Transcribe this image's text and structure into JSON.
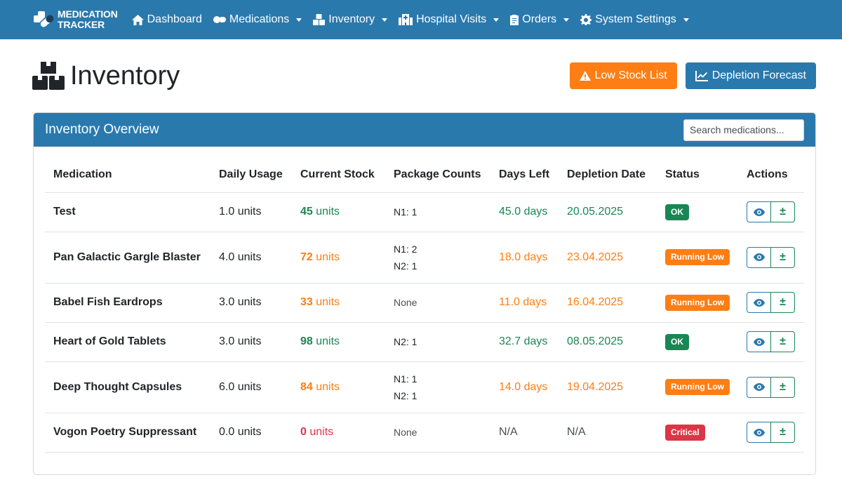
{
  "brand": {
    "line1": "MEDICATION",
    "line2": "TRACKER"
  },
  "nav": [
    {
      "label": "Dashboard",
      "icon": "home-icon",
      "dropdown": false
    },
    {
      "label": "Medications",
      "icon": "pills-icon",
      "dropdown": true
    },
    {
      "label": "Inventory",
      "icon": "boxes-icon",
      "dropdown": true
    },
    {
      "label": "Hospital Visits",
      "icon": "hospital-icon",
      "dropdown": true
    },
    {
      "label": "Orders",
      "icon": "clipboard-icon",
      "dropdown": true
    },
    {
      "label": "System Settings",
      "icon": "gear-icon",
      "dropdown": true
    }
  ],
  "page": {
    "title": "Inventory",
    "low_stock_label": "Low Stock List",
    "forecast_label": "Depletion Forecast"
  },
  "card": {
    "title": "Inventory Overview",
    "search_placeholder": "Search medications..."
  },
  "table": {
    "headers": [
      "Medication",
      "Daily Usage",
      "Current Stock",
      "Package Counts",
      "Days Left",
      "Depletion Date",
      "Status",
      "Actions"
    ],
    "rows": [
      {
        "name": "Test",
        "usage": "1.0 units",
        "stock": "45",
        "stock_unit": "units",
        "packages": [
          "N1: 1"
        ],
        "days": "45.0 days",
        "date": "20.05.2025",
        "status": "OK",
        "level": "ok"
      },
      {
        "name": "Pan Galactic Gargle Blaster",
        "usage": "4.0 units",
        "stock": "72",
        "stock_unit": "units",
        "packages": [
          "N1: 2",
          "N2: 1"
        ],
        "days": "18.0 days",
        "date": "23.04.2025",
        "status": "Running Low",
        "level": "low"
      },
      {
        "name": "Babel Fish Eardrops",
        "usage": "3.0 units",
        "stock": "33",
        "stock_unit": "units",
        "packages": [
          "None"
        ],
        "days": "11.0 days",
        "date": "16.04.2025",
        "status": "Running Low",
        "level": "low"
      },
      {
        "name": "Heart of Gold Tablets",
        "usage": "3.0 units",
        "stock": "98",
        "stock_unit": "units",
        "packages": [
          "N2: 1"
        ],
        "days": "32.7 days",
        "date": "08.05.2025",
        "status": "OK",
        "level": "ok"
      },
      {
        "name": "Deep Thought Capsules",
        "usage": "6.0 units",
        "stock": "84",
        "stock_unit": "units",
        "packages": [
          "N1: 1",
          "N2: 1"
        ],
        "days": "14.0 days",
        "date": "19.04.2025",
        "status": "Running Low",
        "level": "low"
      },
      {
        "name": "Vogon Poetry Suppressant",
        "usage": "0.0 units",
        "stock": "0",
        "stock_unit": "units",
        "packages": [
          "None"
        ],
        "days": "N/A",
        "date": "N/A",
        "status": "Critical",
        "level": "critical"
      }
    ],
    "adjust_symbol": "±"
  },
  "colors": {
    "primary": "#2a79ad",
    "warning": "#fd7e14",
    "success": "#198754",
    "danger": "#dc3545"
  }
}
